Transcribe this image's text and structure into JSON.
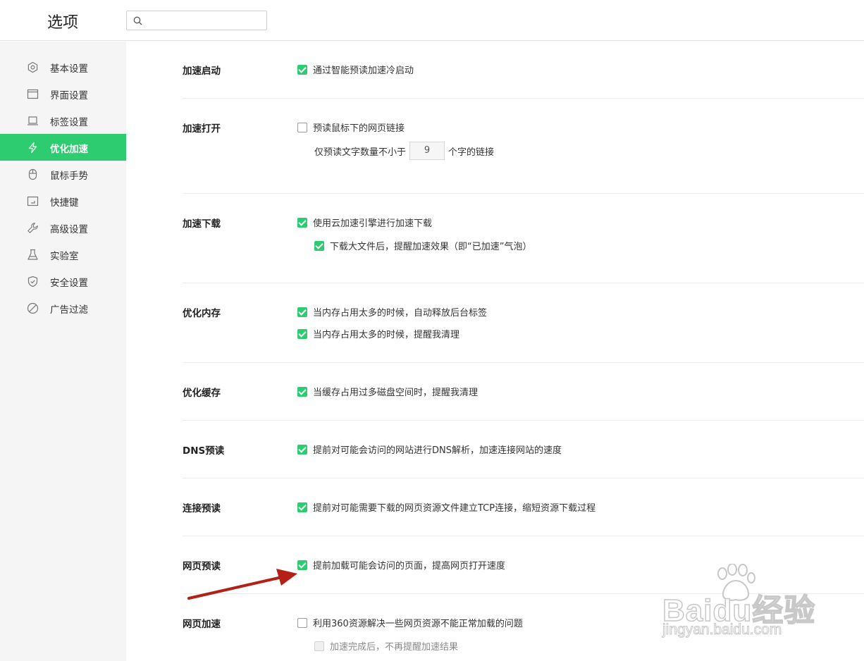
{
  "header": {
    "title": "选项",
    "search": {
      "value": "",
      "placeholder": ""
    }
  },
  "sidebar": {
    "items": [
      {
        "label": "基本设置",
        "icon": "gear-icon"
      },
      {
        "label": "界面设置",
        "icon": "window-icon"
      },
      {
        "label": "标签设置",
        "icon": "tab-icon"
      },
      {
        "label": "优化加速",
        "icon": "lightning-icon",
        "active": true
      },
      {
        "label": "鼠标手势",
        "icon": "mouse-icon"
      },
      {
        "label": "快捷键",
        "icon": "keyboard-icon"
      },
      {
        "label": "高级设置",
        "icon": "wrench-icon"
      },
      {
        "label": "实验室",
        "icon": "flask-icon"
      },
      {
        "label": "安全设置",
        "icon": "shield-icon"
      },
      {
        "label": "广告过滤",
        "icon": "block-icon"
      }
    ]
  },
  "sections": {
    "launch": {
      "title": "加速启动",
      "opt1": {
        "label": "通过智能预读加速冷启动",
        "checked": true
      }
    },
    "open": {
      "title": "加速打开",
      "opt1": {
        "label": "预读鼠标下的网页链接",
        "checked": false
      },
      "min_chars_prefix": "仅预读文字数量不小于",
      "min_chars_value": "9",
      "min_chars_suffix": "个字的链接"
    },
    "download": {
      "title": "加速下载",
      "opt1": {
        "label": "使用云加速引擎进行加速下载",
        "checked": true
      },
      "opt2": {
        "label": "下载大文件后，提醒加速效果（即“已加速”气泡）",
        "checked": true
      }
    },
    "memory": {
      "title": "优化内存",
      "opt1": {
        "label": "当内存占用太多的时候，自动释放后台标签",
        "checked": true
      },
      "opt2": {
        "label": "当内存占用太多的时候，提醒我清理",
        "checked": true
      }
    },
    "cache": {
      "title": "优化缓存",
      "opt1": {
        "label": "当缓存占用过多磁盘空间时，提醒我清理",
        "checked": true
      }
    },
    "dns": {
      "title": "DNS预读",
      "opt1": {
        "label": "提前对可能会访问的网站进行DNS解析，加速连接网站的速度",
        "checked": true
      }
    },
    "connect": {
      "title": "连接预读",
      "opt1": {
        "label": "提前对可能需要下载的网页资源文件建立TCP连接，缩短资源下载过程",
        "checked": true
      }
    },
    "prefetch": {
      "title": "网页预读",
      "opt1": {
        "label": "提前加载可能会访问的页面，提高网页打开速度",
        "checked": true
      }
    },
    "accel": {
      "title": "网页加速",
      "opt1": {
        "label": "利用360资源解决一些网页资源不能正常加载的问题",
        "checked": false
      },
      "opt2": {
        "label": "加速完成后，不再提醒加速结果",
        "checked": false,
        "disabled": true
      }
    }
  },
  "annotation": {
    "arrow_color": "#b22016"
  },
  "watermark": {
    "main": "Baidu经验",
    "sub": "jingyan.baidu.com"
  },
  "colors": {
    "accent": "#2ecc71",
    "sidebar_bg": "#f5f5f5"
  }
}
